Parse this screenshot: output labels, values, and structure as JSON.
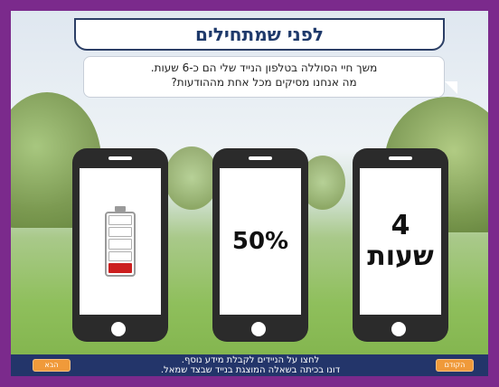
{
  "header": {
    "title": "לפני שמתחילים"
  },
  "bubble": {
    "line1": "משך חיי הסוללה בטלפון הנייד שלי הם כ-6 שעות.",
    "line2": "מה אנחנו מסיקים מכל אחת מההודעות?"
  },
  "phones": {
    "right": {
      "number": "4",
      "word": "שעות"
    },
    "middle": {
      "value": "50%"
    },
    "left": {
      "battery_level": 0.2
    }
  },
  "footer": {
    "line1": "לחצו על הניידים לקבלת מידע נוסף.",
    "line2": "דונו בכיתה בשאלה המוצגת בנייד שבצד שמאל.",
    "prev_label": "הקודם",
    "next_label": "הבא"
  },
  "colors": {
    "frame": "#7b2a8c",
    "title": "#1f3a6b",
    "footer": "#23356a",
    "button": "#f09a3a",
    "battery_fill": "#cc1f1f"
  }
}
